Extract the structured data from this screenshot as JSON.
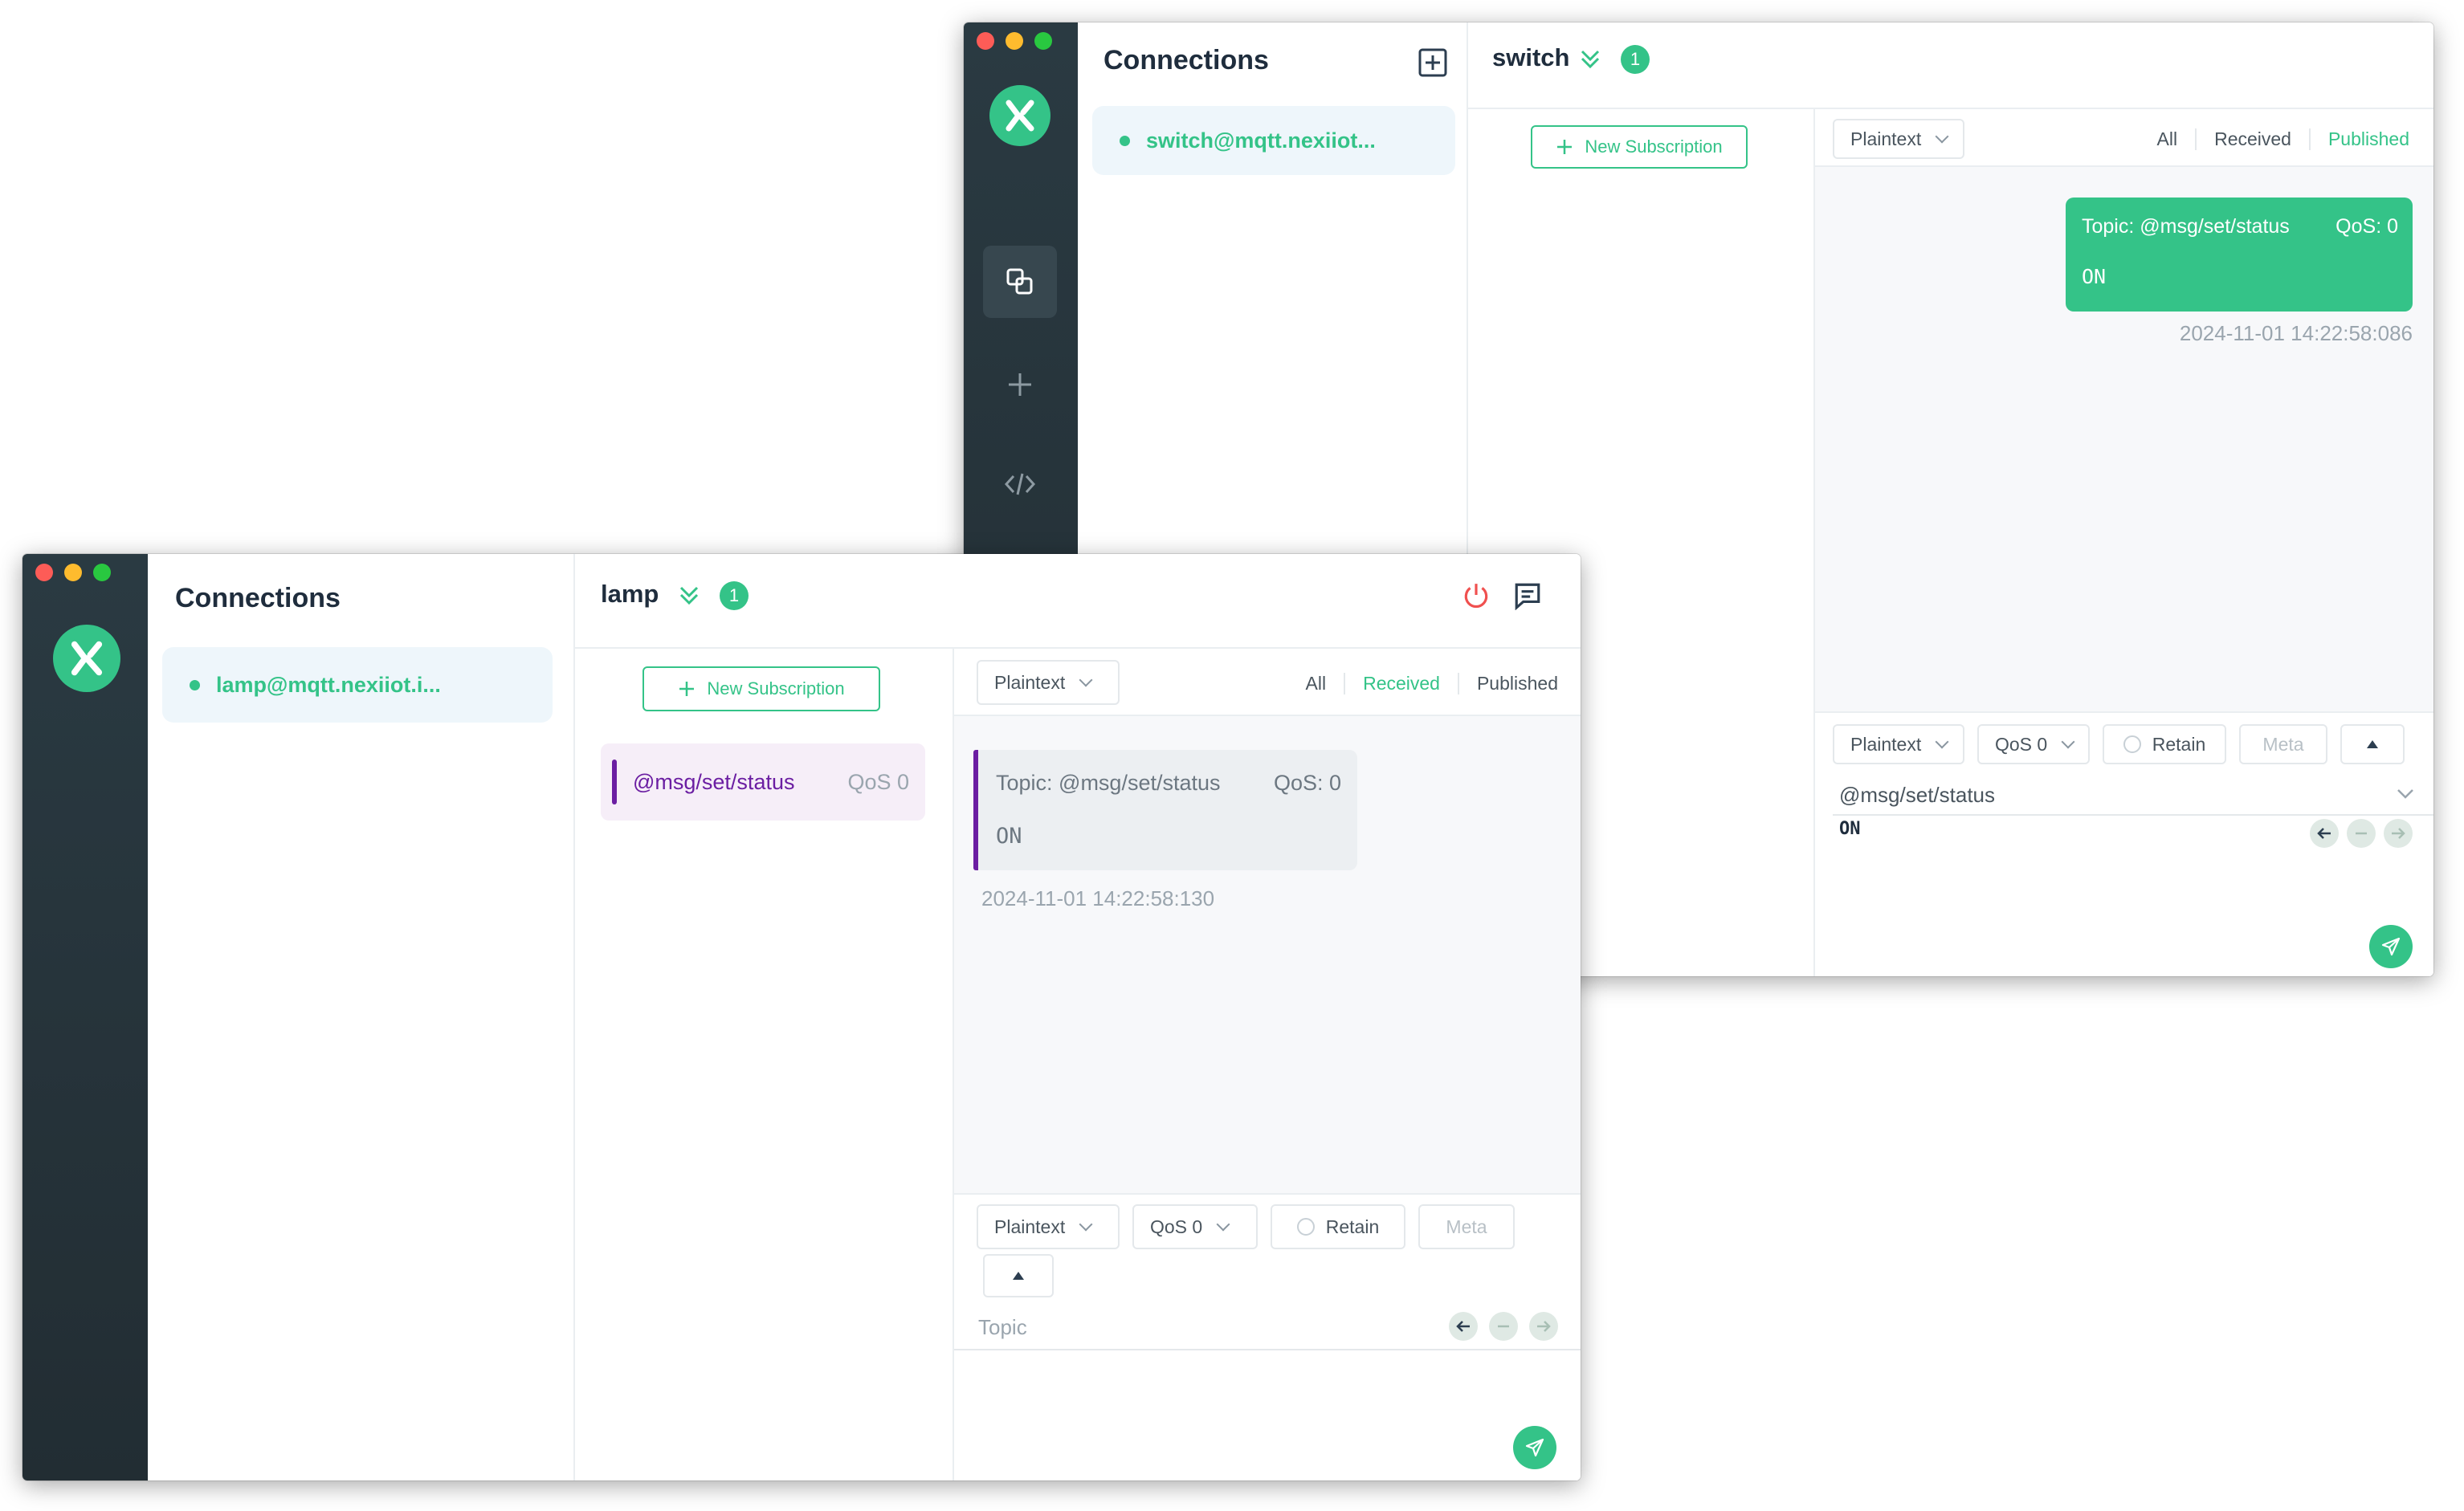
{
  "switch_window": {
    "connections_title": "Connections",
    "connection_item": "switch@mqtt.nexiiot...",
    "header_name": "switch",
    "badge_count": "1",
    "new_subscription": "New Subscription",
    "format": "Plaintext",
    "filters": [
      "All",
      "Received",
      "Published"
    ],
    "active_filter": "Published",
    "message": {
      "topic": "Topic: @msg/set/status",
      "qos": "QoS: 0",
      "payload": "ON",
      "time": "2024-11-01 14:22:58:086"
    },
    "publish": {
      "format": "Plaintext",
      "qos": "QoS 0",
      "retain": "Retain",
      "meta": "Meta",
      "topic": "@msg/set/status",
      "payload": "ON"
    }
  },
  "lamp_window": {
    "connections_title": "Connections",
    "connection_item": "lamp@mqtt.nexiiot.i...",
    "header_name": "lamp",
    "badge_count": "1",
    "new_subscription": "New Subscription",
    "subscription": {
      "topic": "@msg/set/status",
      "qos": "QoS 0"
    },
    "format": "Plaintext",
    "filters": [
      "All",
      "Received",
      "Published"
    ],
    "active_filter": "Received",
    "message": {
      "topic": "Topic: @msg/set/status",
      "qos": "QoS: 0",
      "payload": "ON",
      "time": "2024-11-01 14:22:58:130"
    },
    "publish": {
      "format": "Plaintext",
      "qos": "QoS 0",
      "retain": "Retain",
      "meta": "Meta",
      "topic_placeholder": "Topic"
    }
  },
  "colors": {
    "accent": "#34c388",
    "sidebar": "#2a3a42",
    "subscription": "#6b1ea2",
    "danger": "#f0504f"
  }
}
